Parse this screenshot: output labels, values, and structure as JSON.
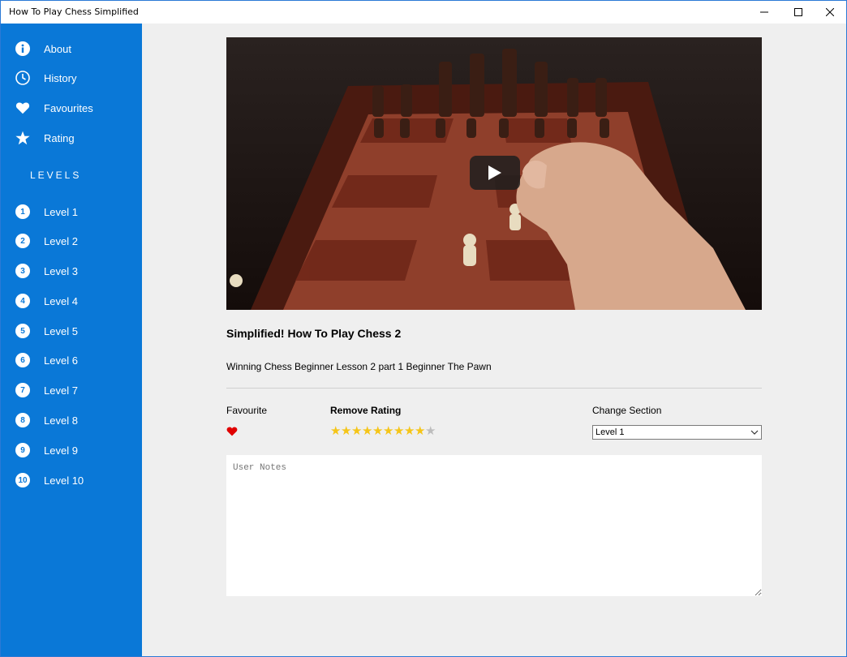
{
  "window": {
    "title": "How To Play Chess Simplified"
  },
  "sidebar": {
    "items": [
      {
        "label": "About",
        "icon": "info-icon"
      },
      {
        "label": "History",
        "icon": "clock-icon"
      },
      {
        "label": "Favourites",
        "icon": "heart-icon"
      },
      {
        "label": "Rating",
        "icon": "star-icon"
      }
    ],
    "levels_header": "LEVELS",
    "levels": [
      {
        "num": "1",
        "label": "Level 1"
      },
      {
        "num": "2",
        "label": "Level 2"
      },
      {
        "num": "3",
        "label": "Level 3"
      },
      {
        "num": "4",
        "label": "Level 4"
      },
      {
        "num": "5",
        "label": "Level 5"
      },
      {
        "num": "6",
        "label": "Level 6"
      },
      {
        "num": "7",
        "label": "Level 7"
      },
      {
        "num": "8",
        "label": "Level 8"
      },
      {
        "num": "9",
        "label": "Level 9"
      },
      {
        "num": "10",
        "label": "Level 10"
      }
    ]
  },
  "video": {
    "title": "Simplified! How To Play Chess 2",
    "description": "Winning Chess Beginner Lesson 2 part 1 Beginner The Pawn"
  },
  "controls": {
    "favourite_label": "Favourite",
    "favourite_on": true,
    "rating_label": "Remove Rating",
    "rating_value": 9,
    "rating_max": 10,
    "section_label": "Change Section",
    "section_value": "Level 1"
  },
  "notes": {
    "placeholder": "User Notes"
  },
  "colors": {
    "sidebar": "#0a78d7",
    "star_on": "#f5c518",
    "star_off": "#bdbdbd",
    "heart": "#e00000"
  }
}
